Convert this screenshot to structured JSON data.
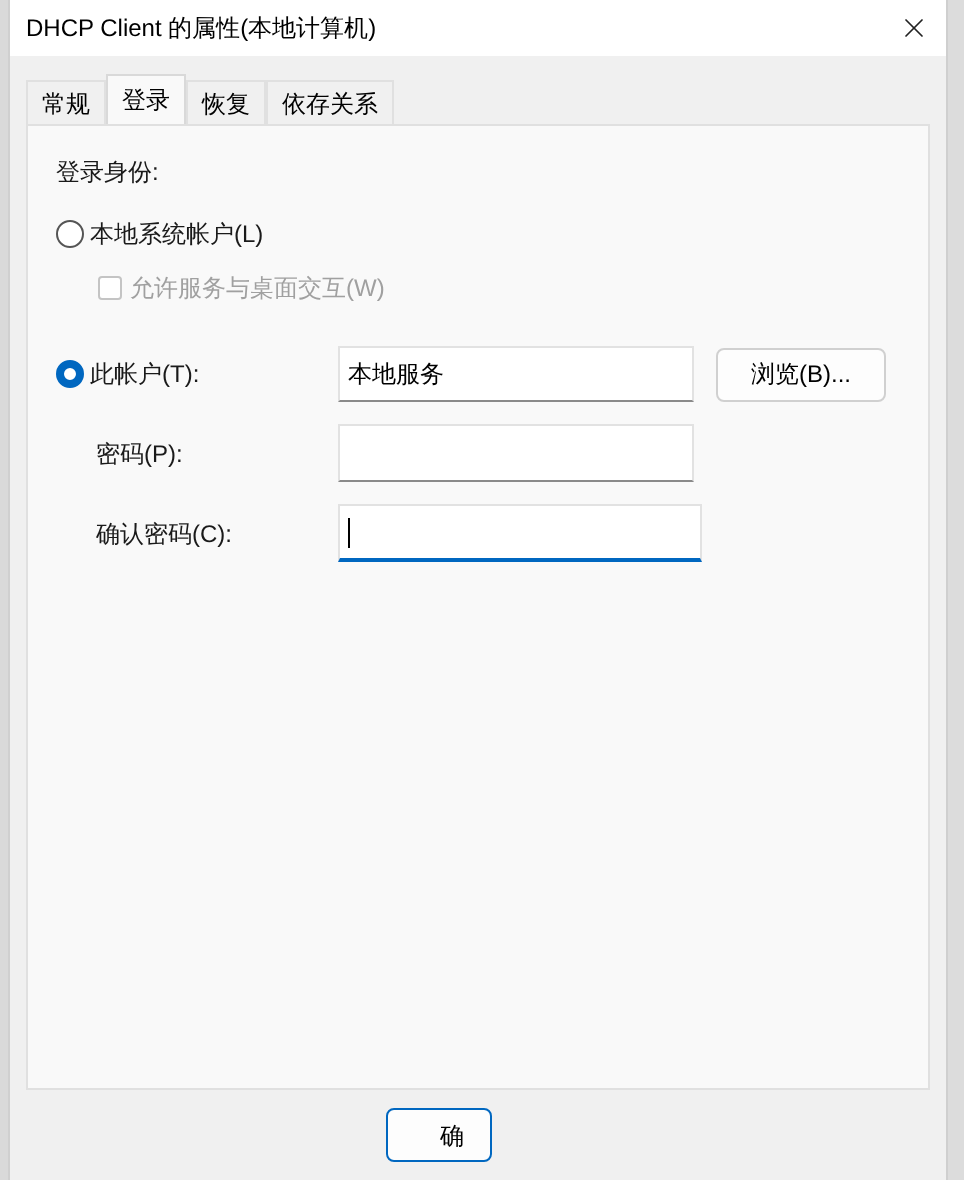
{
  "window": {
    "title": "DHCP Client 的属性(本地计算机)"
  },
  "tabs": [
    {
      "label": "常规",
      "selected": false
    },
    {
      "label": "登录",
      "selected": true
    },
    {
      "label": "恢复",
      "selected": false
    },
    {
      "label": "依存关系",
      "selected": false
    }
  ],
  "logon": {
    "heading": "登录身份:",
    "options": [
      {
        "label": "本地系统帐户(L)",
        "selected": false
      },
      {
        "label": "此帐户(T):",
        "selected": true
      }
    ],
    "interact": {
      "label": "允许服务与桌面交互(W)",
      "checked": false,
      "disabled": true
    },
    "account": {
      "value": "本地服务"
    },
    "browse_button": "浏览(B)...",
    "password_fields": [
      {
        "label": "密码(P):",
        "focused": false
      },
      {
        "label": "确认密码(C):",
        "focused": true
      }
    ]
  },
  "buttons": [
    "确"
  ]
}
